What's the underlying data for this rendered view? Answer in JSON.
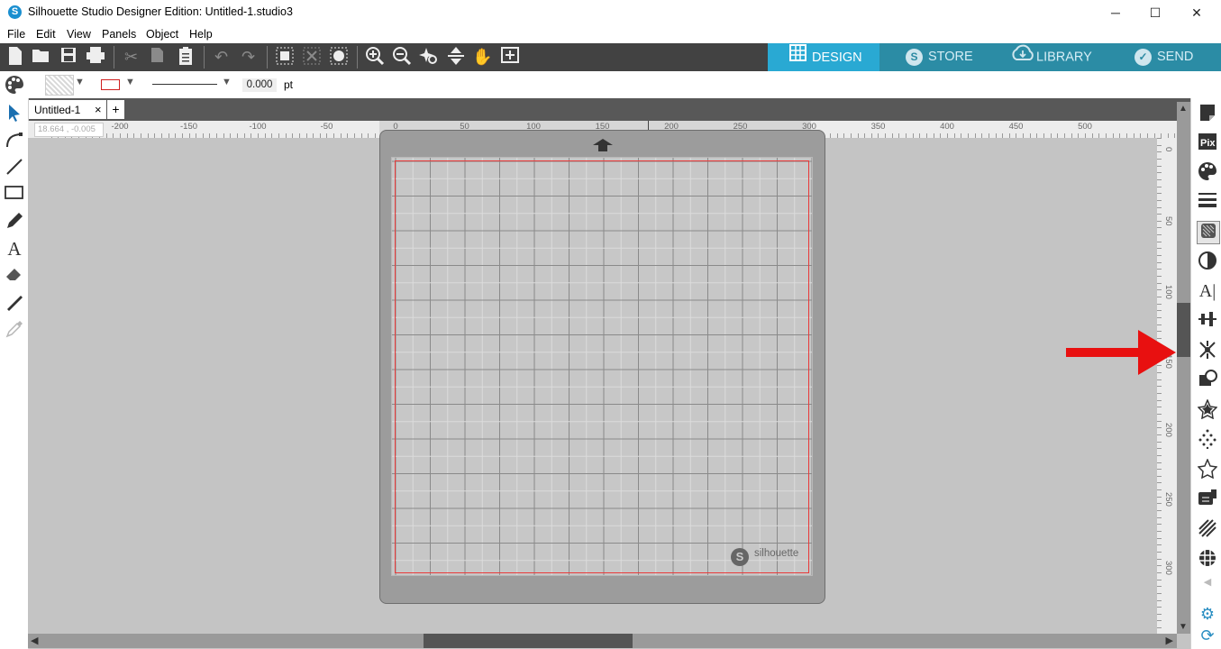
{
  "window": {
    "title": "Silhouette Studio Designer Edition: Untitled-1.studio3",
    "controls": [
      "─",
      "☐",
      "✕"
    ]
  },
  "menu": [
    "File",
    "Edit",
    "View",
    "Panels",
    "Object",
    "Help"
  ],
  "nav_tabs": [
    {
      "label": "DESIGN",
      "active": true
    },
    {
      "label": "STORE",
      "active": false
    },
    {
      "label": "LIBRARY",
      "active": false
    },
    {
      "label": "SEND",
      "active": false
    }
  ],
  "properties": {
    "line_width_value": "0.000",
    "line_width_unit": "pt"
  },
  "document_tabs": [
    {
      "label": "Untitled-1",
      "close": "×"
    }
  ],
  "add_tab_label": "+",
  "cursor_coordinates": "18.664 , -0.005",
  "ruler": {
    "horizontal_labels": [
      "-200",
      "-150",
      "-100",
      "-50",
      "0",
      "50",
      "100",
      "150",
      "200",
      "250",
      "300",
      "350",
      "400",
      "450",
      "500"
    ],
    "vertical_labels": [
      "0",
      "50",
      "100",
      "150",
      "200",
      "250",
      "300"
    ]
  },
  "mat": {
    "brand_text": "silhouette"
  },
  "colors": {
    "toolbar_bg": "#424242",
    "design_tab_active": "#29a9d3",
    "nav_tab_bg": "#2b8ca5",
    "cut_line": "#e83a3a",
    "annotation_arrow": "#e81010"
  }
}
